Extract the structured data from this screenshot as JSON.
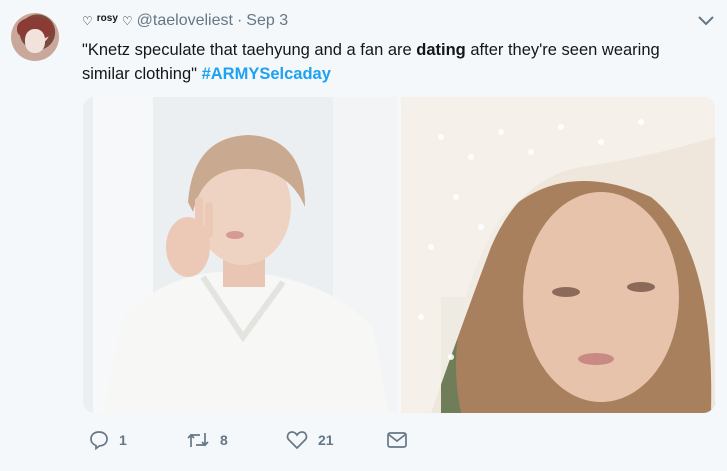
{
  "tweet": {
    "display_name": "rosy",
    "heart_symbol": "♡",
    "handle": "@taeloveliest",
    "separator": "·",
    "date": "Sep 3",
    "text_part1": "\"Knetz speculate that taehyung and a fan are ",
    "text_bold": "dating",
    "text_part2": " after they're seen wearing similar clothing\" ",
    "hashtag": "#ARMYSelcaday",
    "images": [
      {
        "icon": "photo-left"
      },
      {
        "icon": "photo-right"
      }
    ],
    "actions": {
      "reply_count": "1",
      "retweet_count": "8",
      "like_count": "21"
    }
  }
}
